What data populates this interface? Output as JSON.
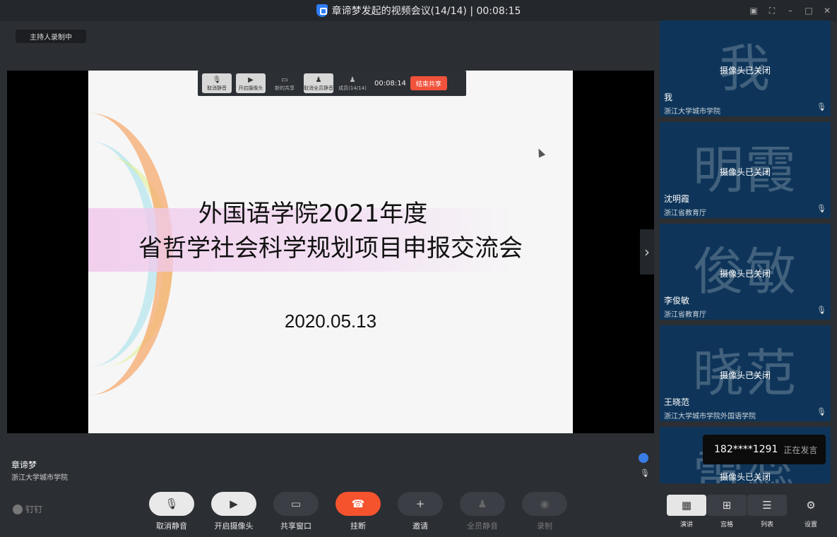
{
  "window": {
    "title": "章谛梦发起的视频会议(14/14) | 00:08:15",
    "controls": [
      "▣",
      "⛶",
      "–",
      "□",
      "✕"
    ]
  },
  "recording_badge": "主持人录制中",
  "slide": {
    "title_line1": "外国语学院2021年度",
    "title_line2": "省哲学社会科学规划项目申报交流会",
    "date": "2020.05.13"
  },
  "mini_toolbar": {
    "buttons": [
      {
        "label": "取消静音",
        "glyph": "🎙"
      },
      {
        "label": "开启摄像头",
        "glyph": "▶"
      },
      {
        "label": "新的共享",
        "glyph": "▭"
      },
      {
        "label": "取消全员静音",
        "glyph": "♟"
      },
      {
        "label": "成员(14/14)",
        "glyph": "♟"
      }
    ],
    "time": "00:08:14",
    "end_label": "结束共享"
  },
  "next_arrow": "›",
  "presenter": {
    "name": "章谛梦",
    "org": "浙江大学城市学院",
    "mic": "🎙"
  },
  "tiles": [
    {
      "bigname": "我",
      "cam": "摄像头已关闭",
      "name": "我",
      "org": "浙江大学城市学院",
      "mic": "🎙"
    },
    {
      "bigname": "明霞",
      "cam": "摄像头已关闭",
      "name": "沈明霞",
      "org": "浙江省教育厅",
      "mic": "🎙"
    },
    {
      "bigname": "俊敏",
      "cam": "摄像头已关闭",
      "name": "李俊敏",
      "org": "浙江省教育厅",
      "mic": "🎙"
    },
    {
      "bigname": "晓范",
      "cam": "摄像头已关闭",
      "name": "王晓范",
      "org": "浙江大学城市学院外国语学院",
      "mic": "🎙"
    },
    {
      "bigname": "雷蕊",
      "cam": "摄像头已关闭",
      "name": "",
      "org": "",
      "mic": ""
    }
  ],
  "speaking": {
    "number": "182****1291",
    "status": "正在发言"
  },
  "bottom": {
    "brand": "钉钉",
    "controls": [
      {
        "label": "取消静音",
        "glyph": "🎙"
      },
      {
        "label": "开启摄像头",
        "glyph": "▶"
      },
      {
        "label": "共享窗口",
        "glyph": "▭"
      },
      {
        "label": "挂断",
        "glyph": "☎"
      },
      {
        "label": "邀请",
        "glyph": "+"
      },
      {
        "label": "全员静音",
        "glyph": "♟"
      },
      {
        "label": "录制",
        "glyph": "◉"
      }
    ],
    "views": [
      {
        "label": "演讲",
        "glyph": "▦"
      },
      {
        "label": "宫格",
        "glyph": "⊞"
      },
      {
        "label": "列表",
        "glyph": "☰"
      },
      {
        "label": "设置",
        "glyph": "⚙"
      }
    ]
  }
}
